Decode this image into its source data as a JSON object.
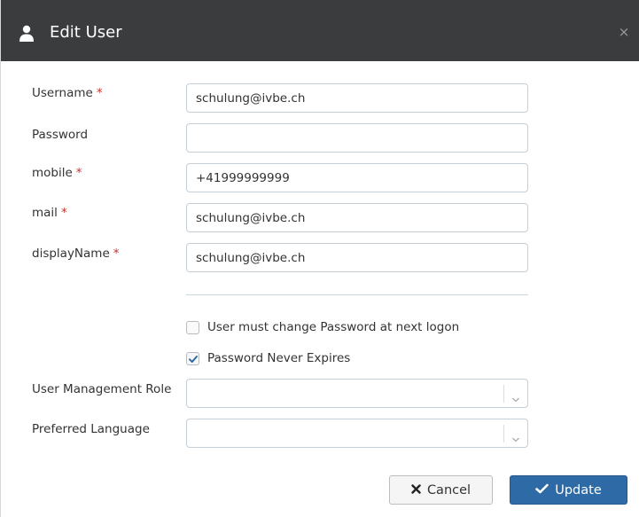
{
  "dialog": {
    "title": "Edit User",
    "user_icon": "user-icon",
    "close_label": "×"
  },
  "fields": {
    "username": {
      "label": "Username",
      "required_mark": "*",
      "value": "schulung@ivbe.ch"
    },
    "password": {
      "label": "Password",
      "value": ""
    },
    "mobile": {
      "label": "mobile",
      "required_mark": "*",
      "value": "+41999999999"
    },
    "mail": {
      "label": "mail",
      "required_mark": "*",
      "value": "schulung@ivbe.ch"
    },
    "display_name": {
      "label": "displayName",
      "required_mark": "*",
      "value": "schulung@ivbe.ch"
    }
  },
  "options": {
    "must_change_password": {
      "label": "User must change Password at next logon",
      "checked": false
    },
    "password_never_expires": {
      "label": "Password Never Expires",
      "checked": true
    }
  },
  "selects": {
    "role": {
      "label": "User Management Role",
      "value": ""
    },
    "language": {
      "label": "Preferred Language",
      "value": ""
    }
  },
  "buttons": {
    "cancel": {
      "label": "Cancel",
      "icon": "times-icon"
    },
    "update": {
      "label": "Update",
      "icon": "check-icon"
    }
  },
  "colors": {
    "header_bg": "#3a3c3e",
    "required": "#c9302c",
    "primary": "#2e6aa6"
  }
}
